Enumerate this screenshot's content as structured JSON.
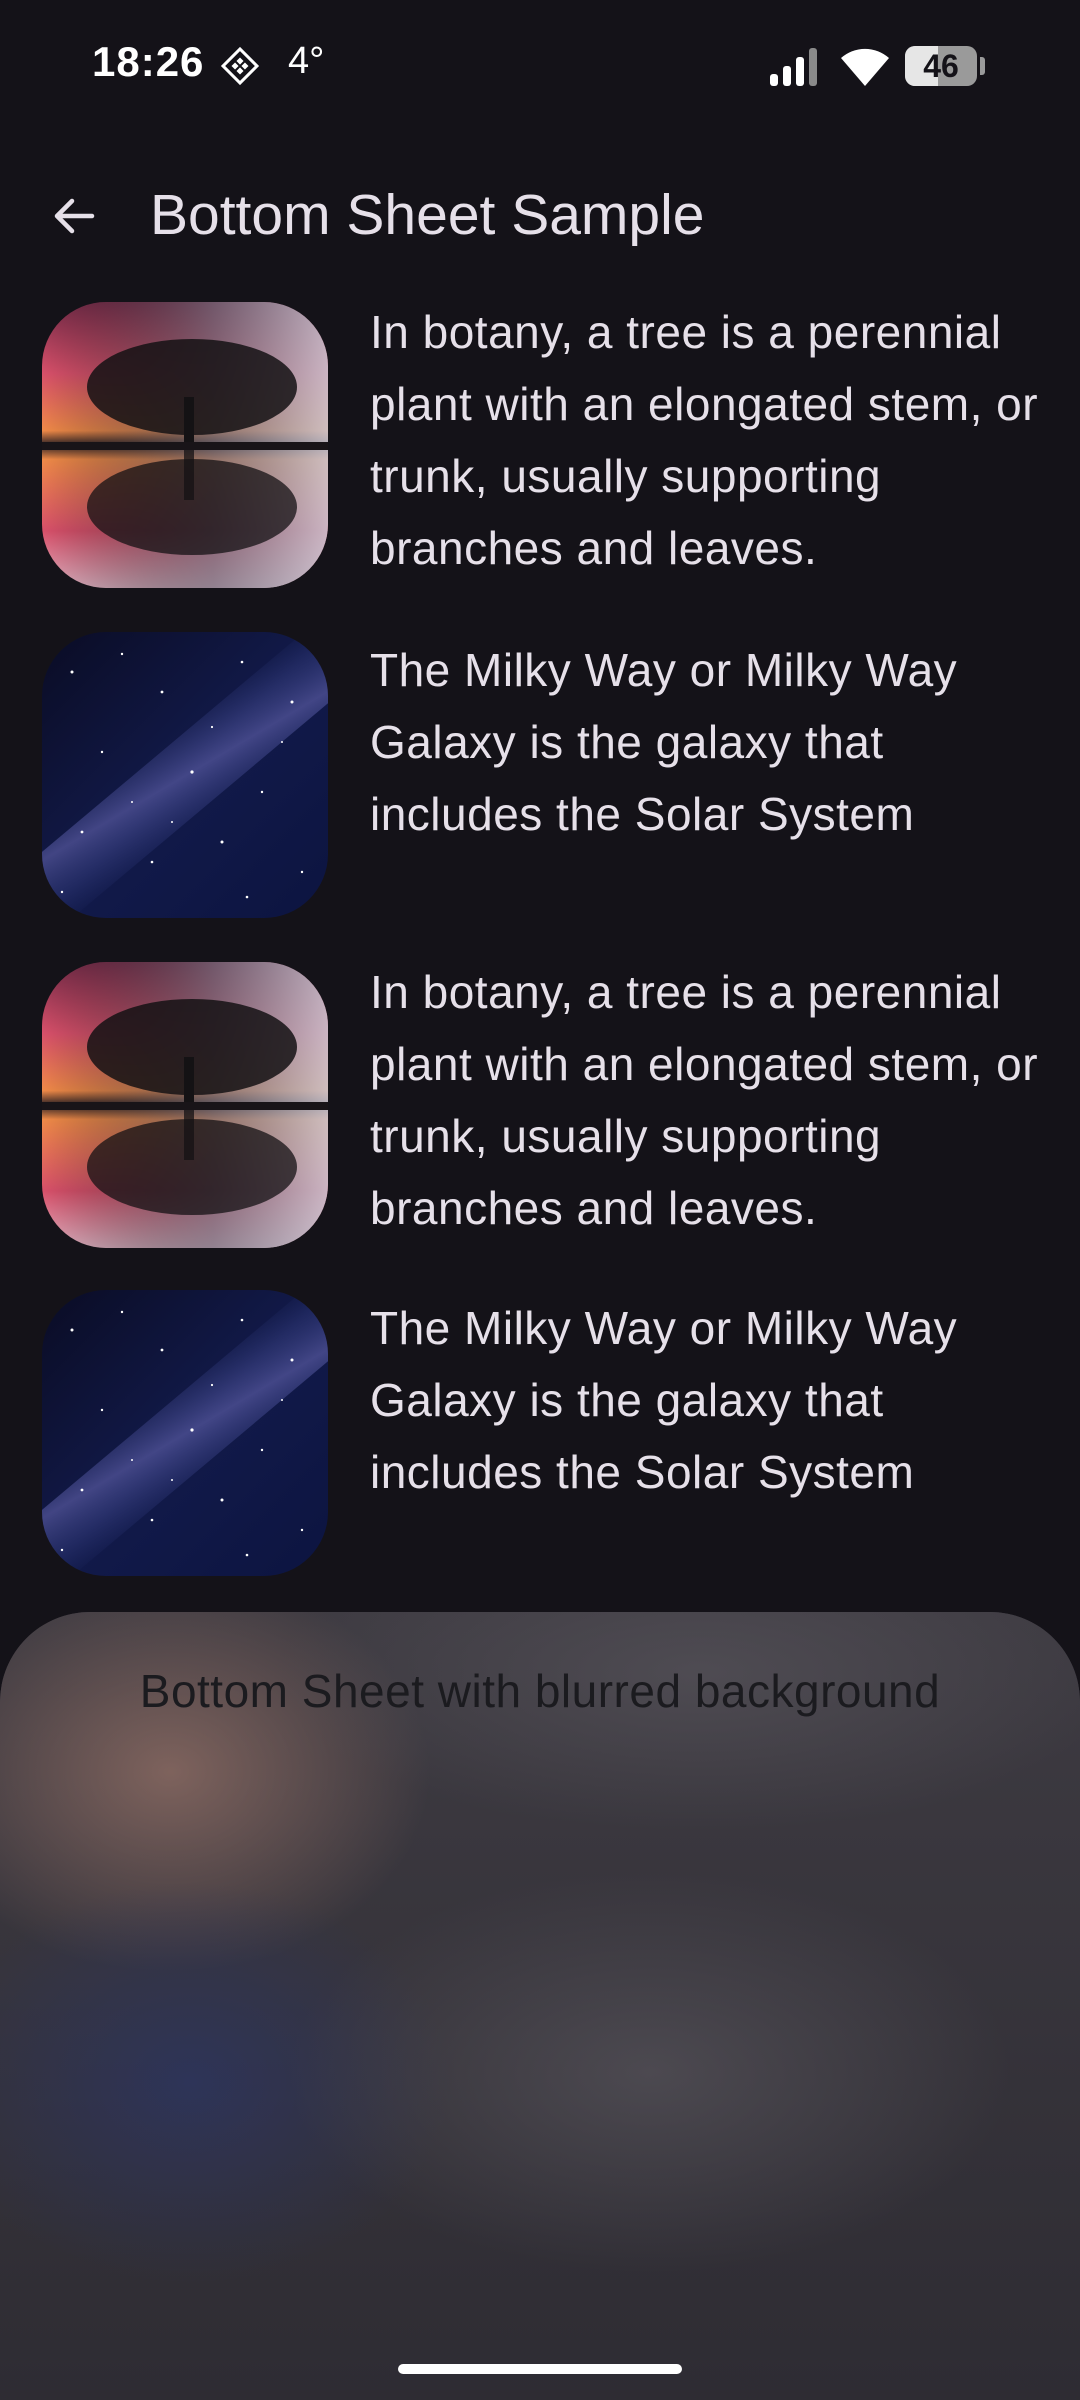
{
  "status_bar": {
    "time": "18:26",
    "temperature": "4°",
    "notification_icon": "diamond-grid-icon",
    "signal_icon": "cell-signal-icon",
    "wifi_icon": "wifi-icon",
    "battery_level": "46",
    "battery_fraction": 0.46
  },
  "app_bar": {
    "back_icon": "arrow-back-icon",
    "title": "Bottom Sheet Sample"
  },
  "list": [
    {
      "image": "tree-reflection-sunset-image",
      "text": "In botany, a tree is a perennial plant with an elongated stem, or trunk, usually supporting branches and leaves."
    },
    {
      "image": "milky-way-night-sky-image",
      "text": "The Milky Way or Milky Way Galaxy is the galaxy that includes the Solar System"
    },
    {
      "image": "tree-reflection-sunset-image",
      "text": "In botany, a tree is a perennial plant with an elongated stem, or trunk, usually supporting branches and leaves."
    },
    {
      "image": "milky-way-night-sky-image",
      "text": "The Milky Way or Milky Way Galaxy is the galaxy that includes the Solar System"
    }
  ],
  "bottom_sheet": {
    "text": "Bottom Sheet with blurred background"
  },
  "colors": {
    "background": "#141218",
    "on_surface": "#e6e0e9",
    "sheet_surface": "#3a3840",
    "sheet_text": "#1b1b1f"
  }
}
